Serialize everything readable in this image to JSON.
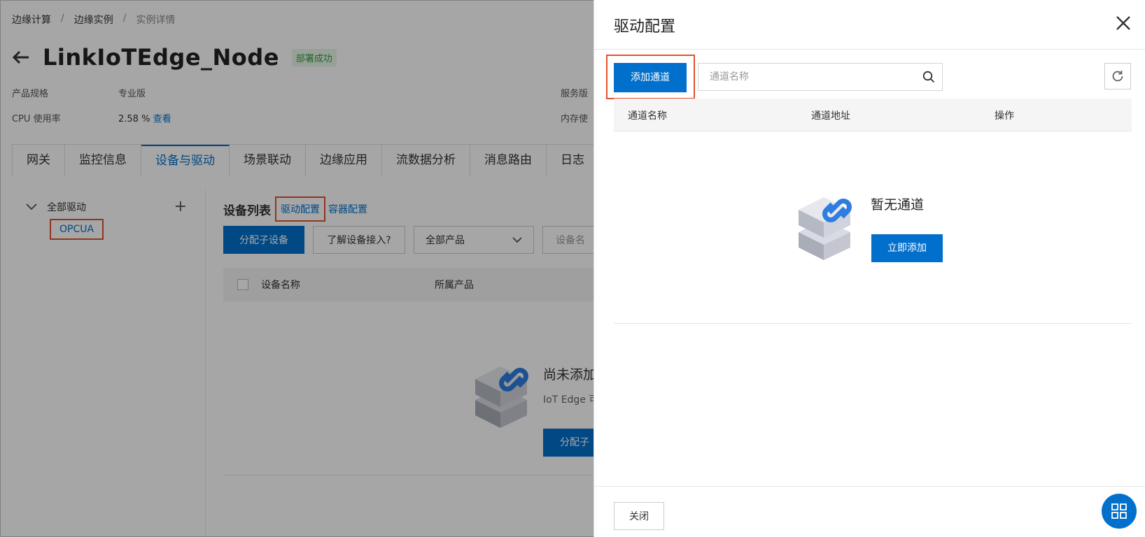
{
  "breadcrumb": [
    "边缘计算",
    "边缘实例",
    "实例详情"
  ],
  "instance": {
    "title": "LinkIoTEdge_Node",
    "status": "部署成功",
    "spec_label": "产品规格",
    "spec_value": "专业版",
    "cpu_label": "CPU 使用率",
    "cpu_value": "2.58 %",
    "cpu_link": "查看",
    "service_label": "服务版",
    "memory_label": "内存使"
  },
  "tabs": [
    "网关",
    "监控信息",
    "设备与驱动",
    "场景联动",
    "边缘应用",
    "流数据分析",
    "消息路由",
    "日志"
  ],
  "active_tab": "设备与驱动",
  "driver_tree": {
    "root": "全部驱动",
    "add_symbol": "+",
    "child": "OPCUA"
  },
  "device_list": {
    "title": "设备列表",
    "driver_config_link": "驱动配置",
    "container_config_link": "容器配置",
    "assign_button": "分配子设备",
    "learn_button": "了解设备接入?",
    "product_select": "全部产品",
    "device_search": "设备名",
    "col_name": "设备名称",
    "col_product": "所属产品",
    "empty_title": "尚未添加",
    "empty_desc": "IoT Edge 可",
    "empty_button": "分配子"
  },
  "drawer": {
    "title": "驱动配置",
    "add_channel_button": "添加通道",
    "search_placeholder": "通道名称",
    "columns": [
      "通道名称",
      "通道地址",
      "操作"
    ],
    "empty_title": "暂无通道",
    "add_now_button": "立即添加",
    "close_button": "关闭"
  },
  "colors": {
    "primary": "#0070cc",
    "highlight": "#e0522f",
    "success": "#3a9b47"
  }
}
